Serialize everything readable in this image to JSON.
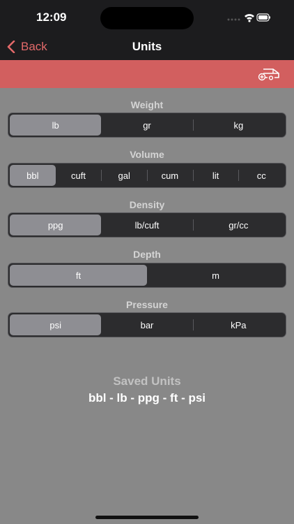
{
  "status": {
    "time": "12:09"
  },
  "nav": {
    "back_label": "Back",
    "title": "Units"
  },
  "toolbar": {
    "icon": "vehicle-add-icon"
  },
  "sections": {
    "weight": {
      "label": "Weight",
      "options": [
        "lb",
        "gr",
        "kg"
      ],
      "selected": "lb"
    },
    "volume": {
      "label": "Volume",
      "options": [
        "bbl",
        "cuft",
        "gal",
        "cum",
        "lit",
        "cc"
      ],
      "selected": "bbl"
    },
    "density": {
      "label": "Density",
      "options": [
        "ppg",
        "lb/cuft",
        "gr/cc"
      ],
      "selected": "ppg"
    },
    "depth": {
      "label": "Depth",
      "options": [
        "ft",
        "m"
      ],
      "selected": "ft"
    },
    "pressure": {
      "label": "Pressure",
      "options": [
        "psi",
        "bar",
        "kPa"
      ],
      "selected": "psi"
    }
  },
  "saved": {
    "title": "Saved Units",
    "value": "bbl - lb - ppg - ft - psi"
  },
  "colors": {
    "accent": "#d25f5f",
    "back_tint": "#e36a6a",
    "background": "#888888",
    "bar": "#1c1c1e"
  }
}
